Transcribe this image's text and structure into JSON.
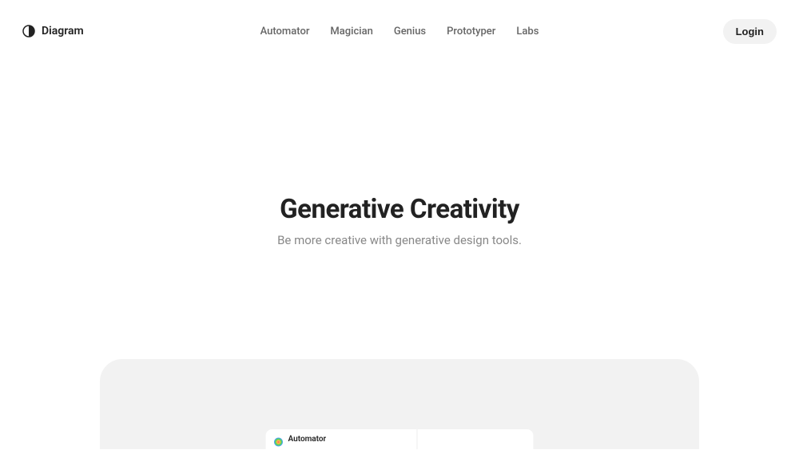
{
  "header": {
    "brand": "Diagram",
    "nav": [
      {
        "label": "Automator"
      },
      {
        "label": "Magician"
      },
      {
        "label": "Genius"
      },
      {
        "label": "Prototyper"
      },
      {
        "label": "Labs"
      }
    ],
    "login_label": "Login"
  },
  "hero": {
    "title": "Generative Creativity",
    "subtitle": "Be more creative with generative design tools."
  },
  "panel": {
    "tab_label": "Automator"
  }
}
